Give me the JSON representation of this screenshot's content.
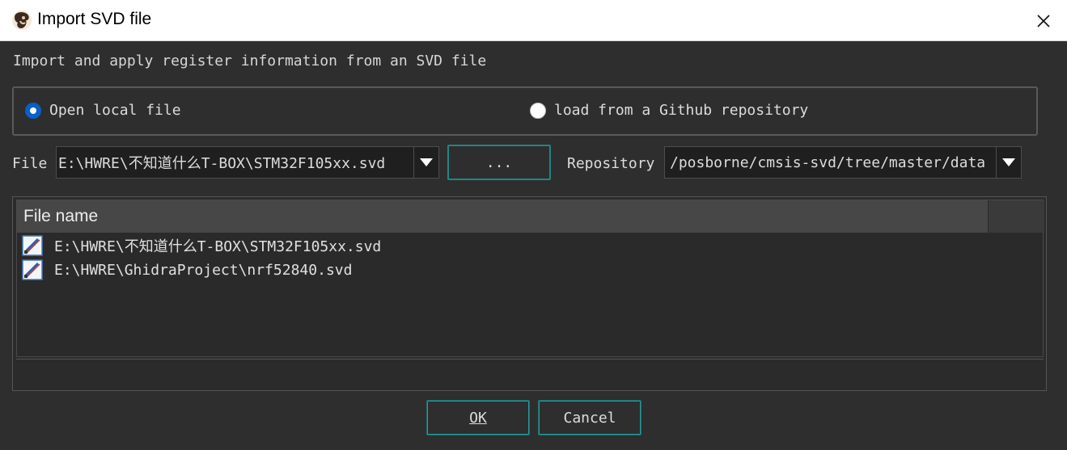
{
  "window": {
    "title": "Import SVD file"
  },
  "description": "Import and apply register information from an SVD file",
  "source": {
    "local_label": "Open local file",
    "github_label": "load from a Github repository",
    "selected": "local"
  },
  "file": {
    "label": "File",
    "value": "E:\\HWRE\\不知道什么T-BOX\\STM32F105xx.svd",
    "browse_label": "..."
  },
  "repository": {
    "label": "Repository",
    "value": "/posborne/cmsis-svd/tree/master/data"
  },
  "table": {
    "header": "File name",
    "rows": [
      {
        "name": "E:\\HWRE\\不知道什么T-BOX\\STM32F105xx.svd"
      },
      {
        "name": "E:\\HWRE\\GhidraProject\\nrf52840.svd"
      }
    ]
  },
  "buttons": {
    "ok": "OK",
    "cancel": "Cancel"
  },
  "colors": {
    "accent_teal": "#238585",
    "radio_blue": "#0b5ec5",
    "bg": "#2e2e2e"
  }
}
